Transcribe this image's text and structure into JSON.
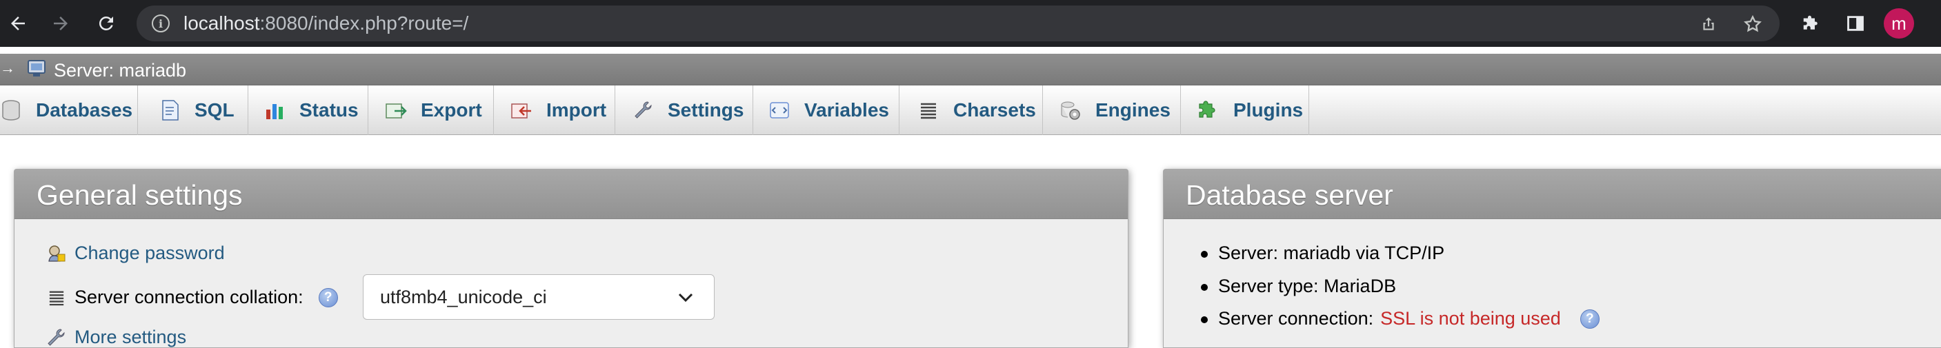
{
  "browser": {
    "url_host": "localhost",
    "url_rest": ":8080/index.php?route=/",
    "profile_initial": "m",
    "profile_color": "#c2185b"
  },
  "breadcrumb": {
    "server_label": "Server: mariadb"
  },
  "tabs": [
    {
      "label": "Databases",
      "icon": "database-icon"
    },
    {
      "label": "SQL",
      "icon": "sql-icon"
    },
    {
      "label": "Status",
      "icon": "status-chart-icon"
    },
    {
      "label": "Export",
      "icon": "export-icon"
    },
    {
      "label": "Import",
      "icon": "import-icon"
    },
    {
      "label": "Settings",
      "icon": "wrench-icon"
    },
    {
      "label": "Variables",
      "icon": "variables-icon"
    },
    {
      "label": "Charsets",
      "icon": "charsets-icon"
    },
    {
      "label": "Engines",
      "icon": "engines-icon"
    },
    {
      "label": "Plugins",
      "icon": "puzzle-icon"
    }
  ],
  "general_settings": {
    "title": "General settings",
    "change_password": "Change password",
    "collation_label": "Server connection collation:",
    "collation_value": "utf8mb4_unicode_ci",
    "more_settings": "More settings"
  },
  "database_server": {
    "title": "Database server",
    "server_line": "Server: mariadb via TCP/IP",
    "type_line": "Server type: MariaDB",
    "connection_label": "Server connection:",
    "connection_value": "SSL is not being used"
  },
  "colors": {
    "link": "#235a81",
    "warning": "#c62828",
    "chrome_bg": "#202124"
  }
}
